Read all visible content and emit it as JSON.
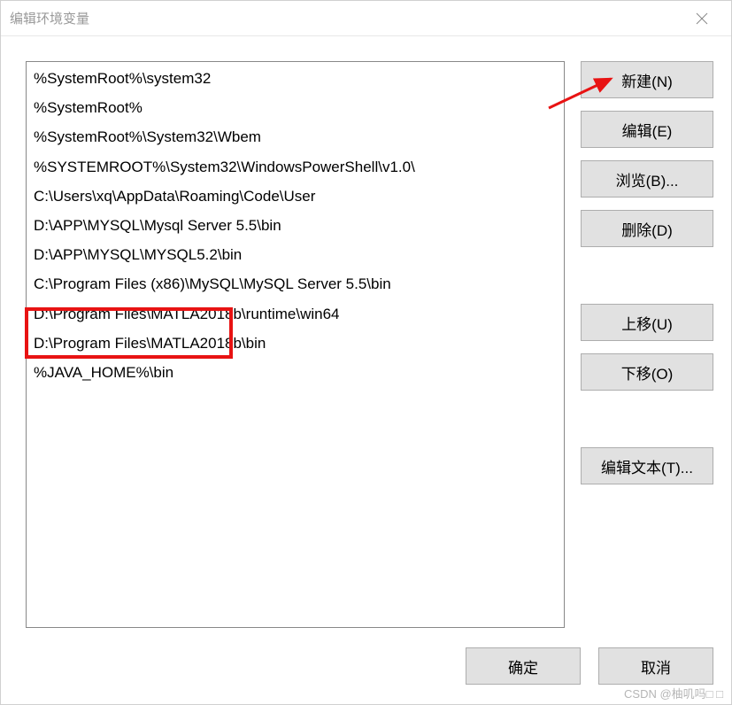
{
  "titlebar": {
    "title": "编辑环境变量"
  },
  "list": {
    "items": [
      "%SystemRoot%\\system32",
      "%SystemRoot%",
      "%SystemRoot%\\System32\\Wbem",
      "%SYSTEMROOT%\\System32\\WindowsPowerShell\\v1.0\\",
      "C:\\Users\\xq\\AppData\\Roaming\\Code\\User",
      "D:\\APP\\MYSQL\\Mysql Server 5.5\\bin",
      "D:\\APP\\MYSQL\\MYSQL5.2\\bin",
      "C:\\Program Files (x86)\\MySQL\\MySQL Server 5.5\\bin",
      "D:\\Program Files\\MATLA2018b\\runtime\\win64",
      "D:\\Program Files\\MATLA2018b\\bin",
      "%JAVA_HOME%\\bin"
    ]
  },
  "buttons": {
    "new": "新建(N)",
    "edit": "编辑(E)",
    "browse": "浏览(B)...",
    "delete": "删除(D)",
    "moveup": "上移(U)",
    "movedown": "下移(O)",
    "edittext": "编辑文本(T)...",
    "ok": "确定",
    "cancel": "取消"
  },
  "watermark": "CSDN @柚叽吗□ □"
}
